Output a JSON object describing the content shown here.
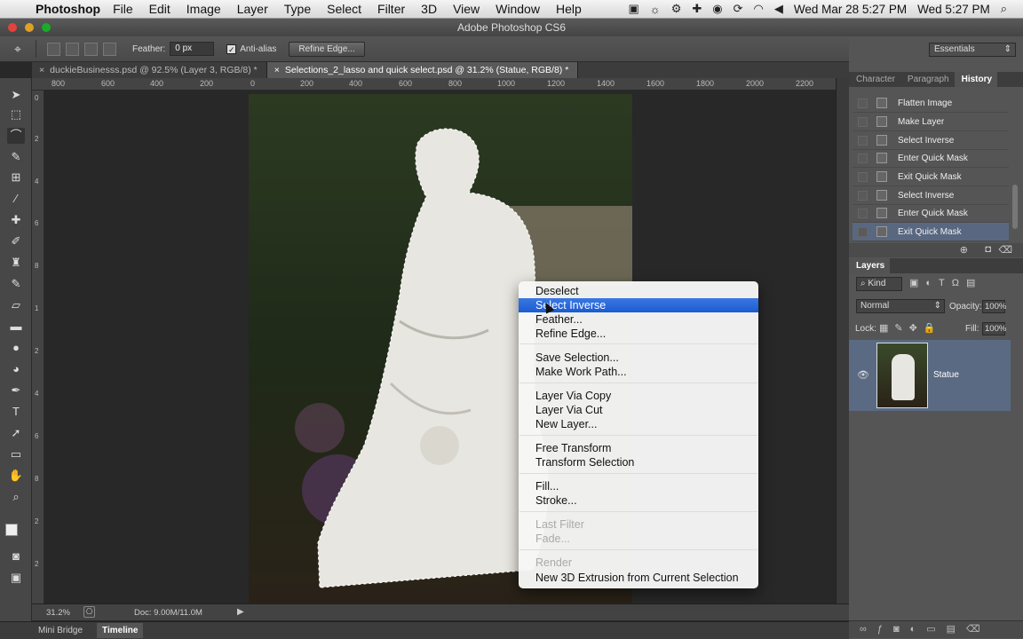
{
  "menubar": {
    "app": "Photoshop",
    "items": [
      "File",
      "Edit",
      "Image",
      "Layer",
      "Type",
      "Select",
      "Filter",
      "3D",
      "View",
      "Window",
      "Help"
    ],
    "datetime1": "Wed Mar 28  5:27 PM",
    "datetime2": "Wed 5:27 PM"
  },
  "window": {
    "title": "Adobe Photoshop CS6"
  },
  "options": {
    "feather_label": "Feather:",
    "feather_value": "0 px",
    "antialias_label": "Anti-alias",
    "antialias_checked": true,
    "refine_edge": "Refine Edge...",
    "workspace": "Essentials"
  },
  "doc_tabs": [
    {
      "label": "duckieBusinesss.psd @ 92.5% (Layer 3, RGB/8) *",
      "active": false
    },
    {
      "label": "Selections_2_lasso and quick select.psd @ 31.2% (Statue, RGB/8) *",
      "active": true
    }
  ],
  "rulers": {
    "top": [
      "800",
      "600",
      "400",
      "200",
      "0",
      "200",
      "400",
      "600",
      "800",
      "1000",
      "1200",
      "1400",
      "1600",
      "1800",
      "2000",
      "2200"
    ],
    "left": [
      "0",
      "2",
      "4",
      "6",
      "8",
      "1",
      "2",
      "4",
      "6",
      "8",
      "2",
      "2"
    ]
  },
  "status": {
    "zoom": "31.2%",
    "doc": "Doc: 9.00M/11.0M"
  },
  "bottom_tabs": [
    "Mini Bridge",
    "Timeline"
  ],
  "history_panel": {
    "tabs": [
      "Character",
      "Paragraph",
      "History"
    ],
    "active_tab": "History",
    "items": [
      "Flatten Image",
      "Make Layer",
      "Select Inverse",
      "Enter Quick Mask",
      "Exit Quick Mask",
      "Select Inverse",
      "Enter Quick Mask",
      "Exit Quick Mask"
    ],
    "selected_index": 7
  },
  "layers_panel": {
    "title": "Layers",
    "kind": "Kind",
    "blend_mode": "Normal",
    "opacity_label": "Opacity:",
    "opacity": "100%",
    "lock_label": "Lock:",
    "fill_label": "Fill:",
    "fill": "100%",
    "layers": [
      {
        "name": "Statue",
        "visible": true
      }
    ]
  },
  "context_menu": {
    "highlighted": "Select Inverse",
    "items": [
      {
        "label": "Deselect"
      },
      {
        "label": "Select Inverse",
        "highlighted": true
      },
      {
        "label": "Feather..."
      },
      {
        "label": "Refine Edge..."
      },
      {
        "label": "Save Selection..."
      },
      {
        "label": "Make Work Path..."
      },
      {
        "label": "Layer Via Copy"
      },
      {
        "label": "Layer Via Cut"
      },
      {
        "label": "New Layer..."
      },
      {
        "label": "Free Transform"
      },
      {
        "label": "Transform Selection"
      },
      {
        "label": "Fill..."
      },
      {
        "label": "Stroke..."
      },
      {
        "label": "Last Filter",
        "disabled": true
      },
      {
        "label": "Fade...",
        "disabled": true
      },
      {
        "label": "Render",
        "disabled": true
      },
      {
        "label": "New 3D Extrusion from Current Selection"
      }
    ]
  },
  "colors": {
    "menu_highlight": "#2a6ad8",
    "history_selected": "#596880",
    "layer_selected": "#5a6a82"
  }
}
